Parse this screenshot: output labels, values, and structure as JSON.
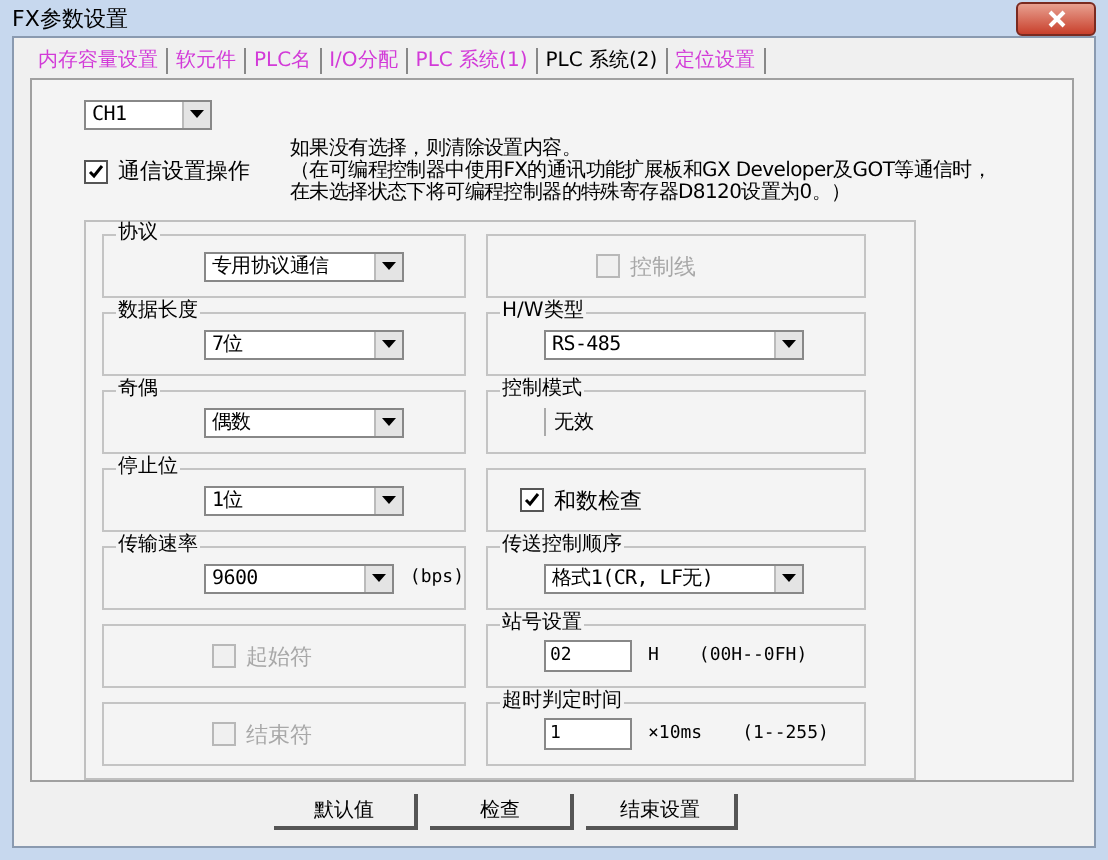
{
  "window": {
    "title": "FX参数设置"
  },
  "tabs": [
    {
      "label": "内存容量设置",
      "selected": false
    },
    {
      "label": "软元件",
      "selected": false
    },
    {
      "label": "PLC名",
      "selected": false
    },
    {
      "label": "I/O分配",
      "selected": false
    },
    {
      "label": "PLC 系统(1)",
      "selected": false
    },
    {
      "label": "PLC 系统(2)",
      "selected": true
    },
    {
      "label": "定位设置",
      "selected": false
    }
  ],
  "channel": {
    "value": "CH1"
  },
  "comm_settings": {
    "label": "通信设置操作",
    "checked": true
  },
  "note": [
    "如果没有选择，则清除设置内容。",
    "（在可编程控制器中使用FX的通讯功能扩展板和GX Developer及GOT等通信时，",
    "在未选择状态下将可编程控制器的特殊寄存器D8120设置为0。）"
  ],
  "left_groups": [
    {
      "kind": "select",
      "title": "协议",
      "value": "专用协议通信"
    },
    {
      "kind": "select",
      "title": "数据长度",
      "value": "7位"
    },
    {
      "kind": "select",
      "title": "奇偶",
      "value": "偶数"
    },
    {
      "kind": "select",
      "title": "停止位",
      "value": "1位"
    },
    {
      "kind": "select",
      "title": "传输速率",
      "value": "9600",
      "unit": "(bps)"
    },
    {
      "kind": "checkbox",
      "label": "起始符",
      "checked": false,
      "disabled": true
    },
    {
      "kind": "checkbox",
      "label": "结束符",
      "checked": false,
      "disabled": true
    }
  ],
  "right_groups": [
    {
      "kind": "checkbox",
      "label": "控制线",
      "checked": false,
      "disabled": true
    },
    {
      "kind": "select",
      "title": "H/W类型",
      "value": "RS-485"
    },
    {
      "kind": "static",
      "title": "控制模式",
      "value": "无效"
    },
    {
      "kind": "checkbox",
      "label": "和数检查",
      "checked": true,
      "disabled": false
    },
    {
      "kind": "select",
      "title": "传送控制顺序",
      "value": "格式1(CR, LF无)"
    },
    {
      "kind": "input",
      "title": "站号设置",
      "value": "02",
      "unit": "H",
      "range": "(00H--0FH)"
    },
    {
      "kind": "input",
      "title": "超时判定时间",
      "value": "1",
      "unit": "×10ms",
      "range": "(1--255)"
    }
  ],
  "buttons": [
    "默认值",
    "检查",
    "结束设置"
  ]
}
